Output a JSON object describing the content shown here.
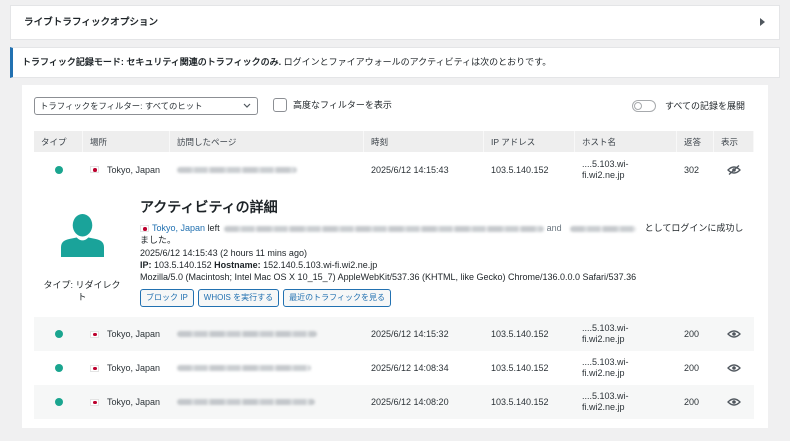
{
  "live_traffic_options": {
    "title": "ライブトラフィックオプション",
    "toggle_icon": "caret-right-icon"
  },
  "notice": {
    "mode_label": "トラフィック記録モード: セキュリティ関連のトラフィックのみ.",
    "message": "ログインとファイアウォールのアクティビティは次のとおりです。"
  },
  "filters": {
    "filter_select": {
      "selected": "トラフィックをフィルター: すべてのヒット"
    },
    "advanced_filters": {
      "label": "高度なフィルターを表示",
      "checked": false
    },
    "expand_all": {
      "label": "すべての記録を展開",
      "on": false
    }
  },
  "table": {
    "headers": {
      "type": "タイプ",
      "location": "場所",
      "page": "訪問したページ",
      "time": "時刻",
      "ip": "IP アドレス",
      "hostname": "ホスト名",
      "response": "返答",
      "view": "表示"
    },
    "rows": [
      {
        "location": "Tokyo, Japan",
        "time": "2025/6/12 14:15:43",
        "ip": "103.5.140.152",
        "hostname": "....5.103.wi-fi.wi2.ne.jp",
        "response": "302",
        "view_icon": "eye-slash-icon",
        "expanded": true
      },
      {
        "location": "Tokyo, Japan",
        "time": "2025/6/12 14:15:32",
        "ip": "103.5.140.152",
        "hostname": "....5.103.wi-fi.wi2.ne.jp",
        "response": "200",
        "view_icon": "eye-icon",
        "expanded": false
      },
      {
        "location": "Tokyo, Japan",
        "time": "2025/6/12 14:08:34",
        "ip": "103.5.140.152",
        "hostname": "....5.103.wi-fi.wi2.ne.jp",
        "response": "200",
        "view_icon": "eye-icon",
        "expanded": false
      },
      {
        "location": "Tokyo, Japan",
        "time": "2025/6/12 14:08:20",
        "ip": "103.5.140.152",
        "hostname": "....5.103.wi-fi.wi2.ne.jp",
        "response": "200",
        "view_icon": "eye-icon",
        "expanded": false
      }
    ]
  },
  "detail": {
    "title": "アクティビティの詳細",
    "type_label": "タイプ: リダイレクト",
    "avatar_icon": "user-silhouette-icon",
    "location": "Tokyo, Japan",
    "left_word": "left",
    "and_word": "and",
    "result_text": "としてログインに成功しました。",
    "timestamp": "2025/6/12 14:15:43 (2 hours 11 mins ago)",
    "ip_label": "IP:",
    "ip": "103.5.140.152",
    "hostname_label": "Hostname:",
    "hostname": "152.140.5.103.wi-fi.wi2.ne.jp",
    "user_agent": "Mozilla/5.0 (Macintosh; Intel Mac OS X 10_15_7) AppleWebKit/537.36 (KHTML, like Gecko) Chrome/136.0.0.0 Safari/537.36",
    "buttons": {
      "block_ip": "ブロック IP",
      "whois": "WHOIS を実行する",
      "recent_traffic": "最近のトラフィックを見る"
    }
  },
  "colors": {
    "accent": "#2271b1",
    "status_dot": "#1aa58f",
    "avatar": "#1aa39a",
    "flag_red": "#bc002d",
    "row_alt": "#f6f7f7",
    "header_bg": "#eeeeee"
  }
}
